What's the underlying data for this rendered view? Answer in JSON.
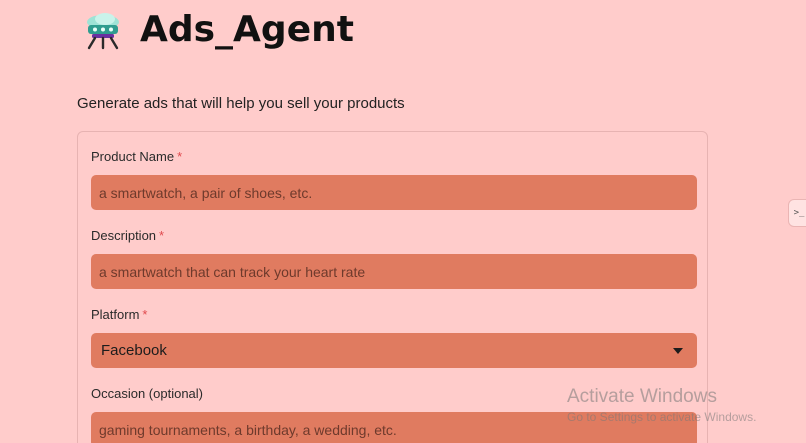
{
  "app": {
    "title": "Ads_Agent",
    "logo_icon": "ufo-robot-icon",
    "subtitle": "Generate ads that will help you sell your products"
  },
  "form": {
    "product_name": {
      "label": "Product Name",
      "required_mark": "*",
      "value": "",
      "placeholder": "a smartwatch, a pair of shoes, etc."
    },
    "description": {
      "label": "Description",
      "required_mark": "*",
      "value": "",
      "placeholder": "a smartwatch that can track your heart rate"
    },
    "platform": {
      "label": "Platform",
      "required_mark": "*",
      "selected": "Facebook"
    },
    "occasion": {
      "label": "Occasion (optional)",
      "value": "",
      "placeholder": "gaming tournaments, a birthday, a wedding, etc."
    }
  },
  "sidebar_toggle": {
    "glyph": ">_"
  },
  "watermark": {
    "line1": "Activate Windows",
    "line2": "Go to Settings to activate Windows."
  },
  "colors": {
    "background": "#ffcccb",
    "input_fill": "#e07b60",
    "required_star": "#e0494d"
  }
}
